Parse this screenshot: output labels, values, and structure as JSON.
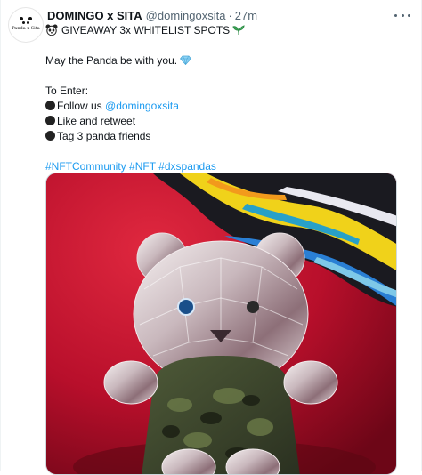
{
  "author": {
    "avatar_text": "Panda x Sita",
    "display_name": "DOMINGO x SITA",
    "handle": "@domingoxsita",
    "separator": "·",
    "time": "27m"
  },
  "tweet": {
    "title_line": "GIVEAWAY 3x WHITELIST SPOTS",
    "line_panda": "May the Panda be with you.",
    "to_enter": "To Enter:",
    "follow_prefix": "Follow us ",
    "follow_mention": "@domingoxsita",
    "step_like": "Like and retweet",
    "step_tag": "Tag 3 panda friends",
    "hashtags": [
      "#NFTCommunity",
      "#NFT",
      "#dxspandas"
    ]
  },
  "icons": {
    "title_left": "panda-icon",
    "title_right": "seedling-icon",
    "panda_line": "gem-icon",
    "bullets": "black-circle-icon",
    "menu": "more-icon"
  },
  "colors": {
    "link": "#1d9bf0",
    "secondary_text": "#536471",
    "media_background": "#b00f2a"
  }
}
